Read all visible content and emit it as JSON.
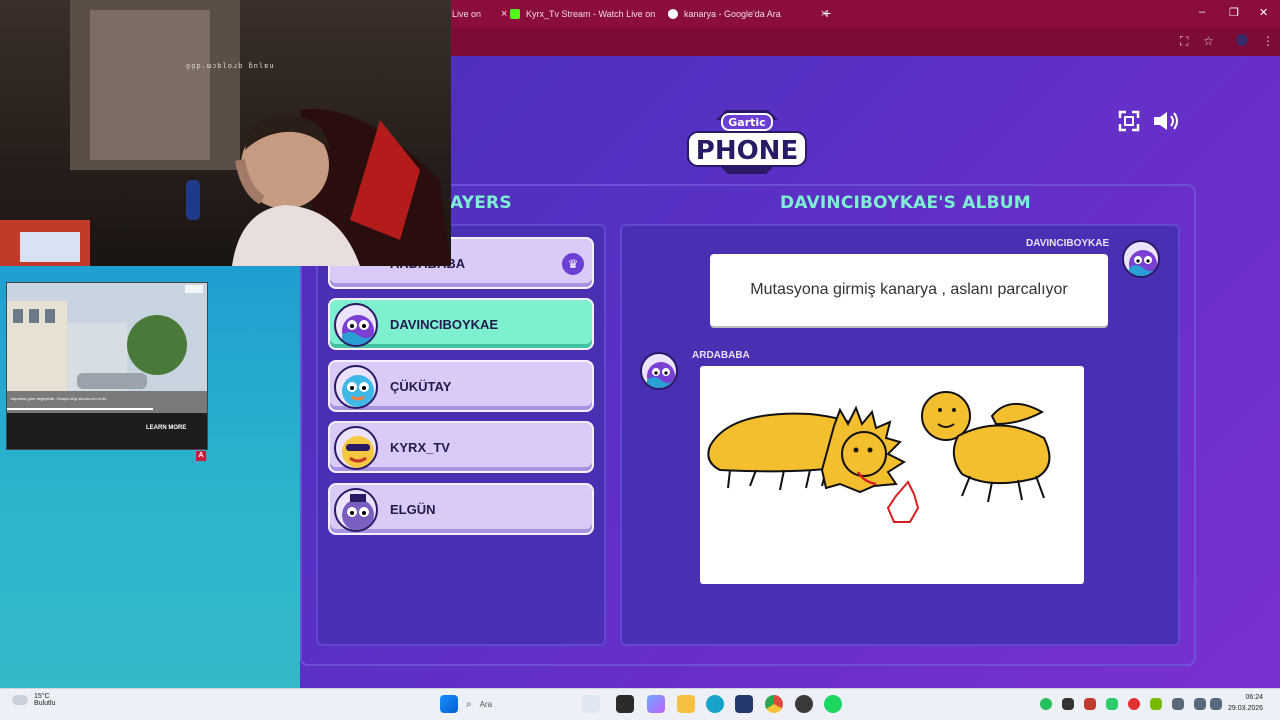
{
  "browser": {
    "tabs": [
      {
        "label": "Live on",
        "close": "×"
      },
      {
        "label": "Kyrx_Tv Stream - Watch Live on",
        "close": "×"
      },
      {
        "label": "kanarya - Google'da Ara",
        "close": "×"
      }
    ],
    "new_tab": "+",
    "window_controls": {
      "minimize": "–",
      "restore": "❐",
      "close": "✕"
    }
  },
  "game": {
    "logo_top": "Gartic",
    "logo_bottom": "PHONE",
    "players_title": "AYERS",
    "album_title": "DAVINCIBOYKAE'S ALBUM",
    "players": [
      {
        "name": "ARDABABA",
        "host": true,
        "active": false
      },
      {
        "name": "DAVINCIBOYKAE",
        "host": false,
        "active": true
      },
      {
        "name": "ÇÜKÜTAY",
        "host": false,
        "active": false
      },
      {
        "name": "KYRX_TV",
        "host": false,
        "active": false
      },
      {
        "name": "ELGÜN",
        "host": false,
        "active": false
      }
    ],
    "album": {
      "entry1_author": "DAVINCIBOYKAE",
      "entry1_text": "Mutasyona girmiş kanarya , aslanı parcalıyor",
      "entry2_author": "ARDABABA"
    }
  },
  "webcam": {
    "overlay_text": "ǫǫp.ɯɔbloɹb ƃnlɐu"
  },
  "ad": {
    "caption": "kapatma güre değişebilir. Detaylı bilgi skoda.com.tr'de",
    "button": "LEARN MORE",
    "marker": "A"
  },
  "taskbar": {
    "weather_temp": "15°C",
    "weather_desc": "Bulutlu",
    "search_placeholder": "Ara",
    "time": "06:24",
    "date": "29.03.2026"
  },
  "colors": {
    "accent_title": "#7df0d2",
    "active_player": "#7df0cf",
    "player_bg": "#d9caf7"
  }
}
